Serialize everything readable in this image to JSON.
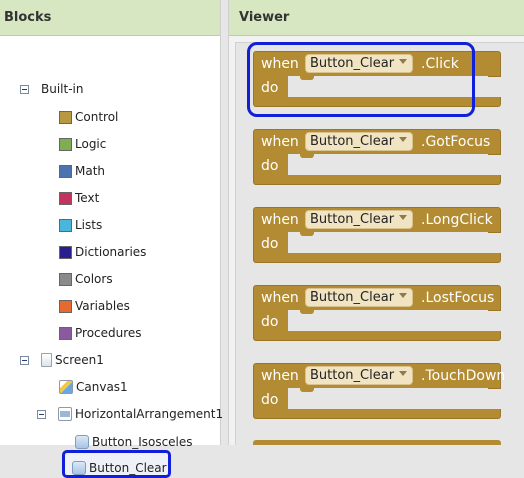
{
  "blocks_panel": {
    "title": "Blocks",
    "built_in": {
      "label": "Built-in",
      "items": [
        {
          "label": "Control",
          "color": "#b89840"
        },
        {
          "label": "Logic",
          "color": "#7fae52"
        },
        {
          "label": "Math",
          "color": "#4a73b0"
        },
        {
          "label": "Text",
          "color": "#c2335e"
        },
        {
          "label": "Lists",
          "color": "#4bb6dc"
        },
        {
          "label": "Dictionaries",
          "color": "#2a1d8e"
        },
        {
          "label": "Colors",
          "color": "#8a8a8a"
        },
        {
          "label": "Variables",
          "color": "#e46a2d"
        },
        {
          "label": "Procedures",
          "color": "#8a5a9e"
        }
      ]
    },
    "screen": {
      "label": "Screen1",
      "canvas": "Canvas1",
      "arrangement": {
        "label": "HorizontalArrangement1",
        "children": [
          "Button_Isosceles",
          "Button_Clear"
        ]
      }
    }
  },
  "viewer": {
    "title": "Viewer",
    "blocks": [
      {
        "when": "when",
        "component": "Button_Clear",
        "event": ".Click",
        "do": "do"
      },
      {
        "when": "when",
        "component": "Button_Clear",
        "event": ".GotFocus",
        "do": "do"
      },
      {
        "when": "when",
        "component": "Button_Clear",
        "event": ".LongClick",
        "do": "do"
      },
      {
        "when": "when",
        "component": "Button_Clear",
        "event": ".LostFocus",
        "do": "do"
      },
      {
        "when": "when",
        "component": "Button_Clear",
        "event": ".TouchDown",
        "do": "do"
      }
    ]
  },
  "colors": {
    "header_bg": "#d6e7c2",
    "event_block": "#b28b32",
    "highlight": "#1020d8"
  }
}
